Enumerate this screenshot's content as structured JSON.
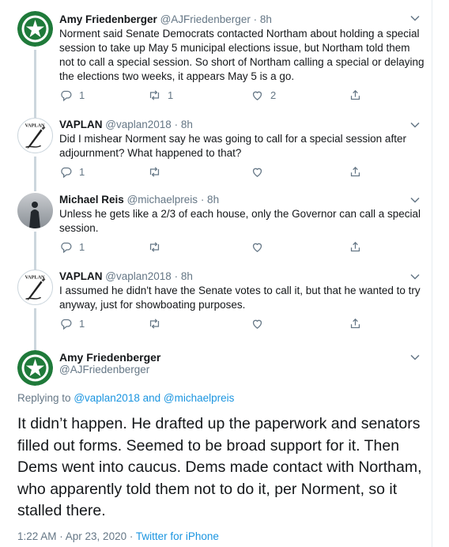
{
  "colors": {
    "accent": "#1b95e0",
    "muted": "#657786",
    "text": "#14171a",
    "divider": "#e6ecf0"
  },
  "tweets": [
    {
      "name": "Amy Friedenberger",
      "handle": "@AJFriedenberger",
      "time": "· 8h",
      "avatar": "amy-avatar",
      "text": "Norment said Senate Democrats contacted Northam about holding a special session to take up May 5 municipal elections issue, but Northam told them not to call a special session. So short of Northam calling a special or delaying the elections two weeks, it appears May 5 is a go.",
      "reply_count": "1",
      "retweet_count": "1",
      "like_count": "2"
    },
    {
      "name": "VAPLAN",
      "handle": "@vaplan2018",
      "time": "· 8h",
      "avatar": "vaplan-avatar",
      "avatar_text": "VAPLAN",
      "text": "Did I mishear Norment say he was going to call for a special session after adjournment? What happened to that?",
      "reply_count": "1",
      "retweet_count": "",
      "like_count": ""
    },
    {
      "name": "Michael Reis",
      "handle": "@michaelpreis",
      "time": "· 8h",
      "avatar": "michael-avatar",
      "text": "Unless he gets like a 2/3 of each house, only the Governor can call a special session.",
      "reply_count": "1",
      "retweet_count": "",
      "like_count": ""
    },
    {
      "name": "VAPLAN",
      "handle": "@vaplan2018",
      "time": "· 8h",
      "avatar": "vaplan-avatar",
      "avatar_text": "VAPLAN",
      "text": "I assumed he didn't have the Senate votes to call it, but that he wanted to try anyway, just for showboating purposes.",
      "reply_count": "1",
      "retweet_count": "",
      "like_count": ""
    }
  ],
  "main_tweet": {
    "name": "Amy Friedenberger",
    "handle": "@AJFriedenberger",
    "replying_prefix": "Replying to",
    "replying_user1": "@vaplan2018",
    "replying_and": "and",
    "replying_user2": "@michaelpreis",
    "text": "It didn’t happen. He drafted up the paperwork and senators filled out forms. Seemed to be broad support for it. Then Dems went into caucus. Dems made contact with Northam, who apparently told them not to do it, per Norment, so it stalled there.",
    "timestamp": "1:22 AM · Apr 23, 2020 · ",
    "source": "Twitter for iPhone"
  }
}
